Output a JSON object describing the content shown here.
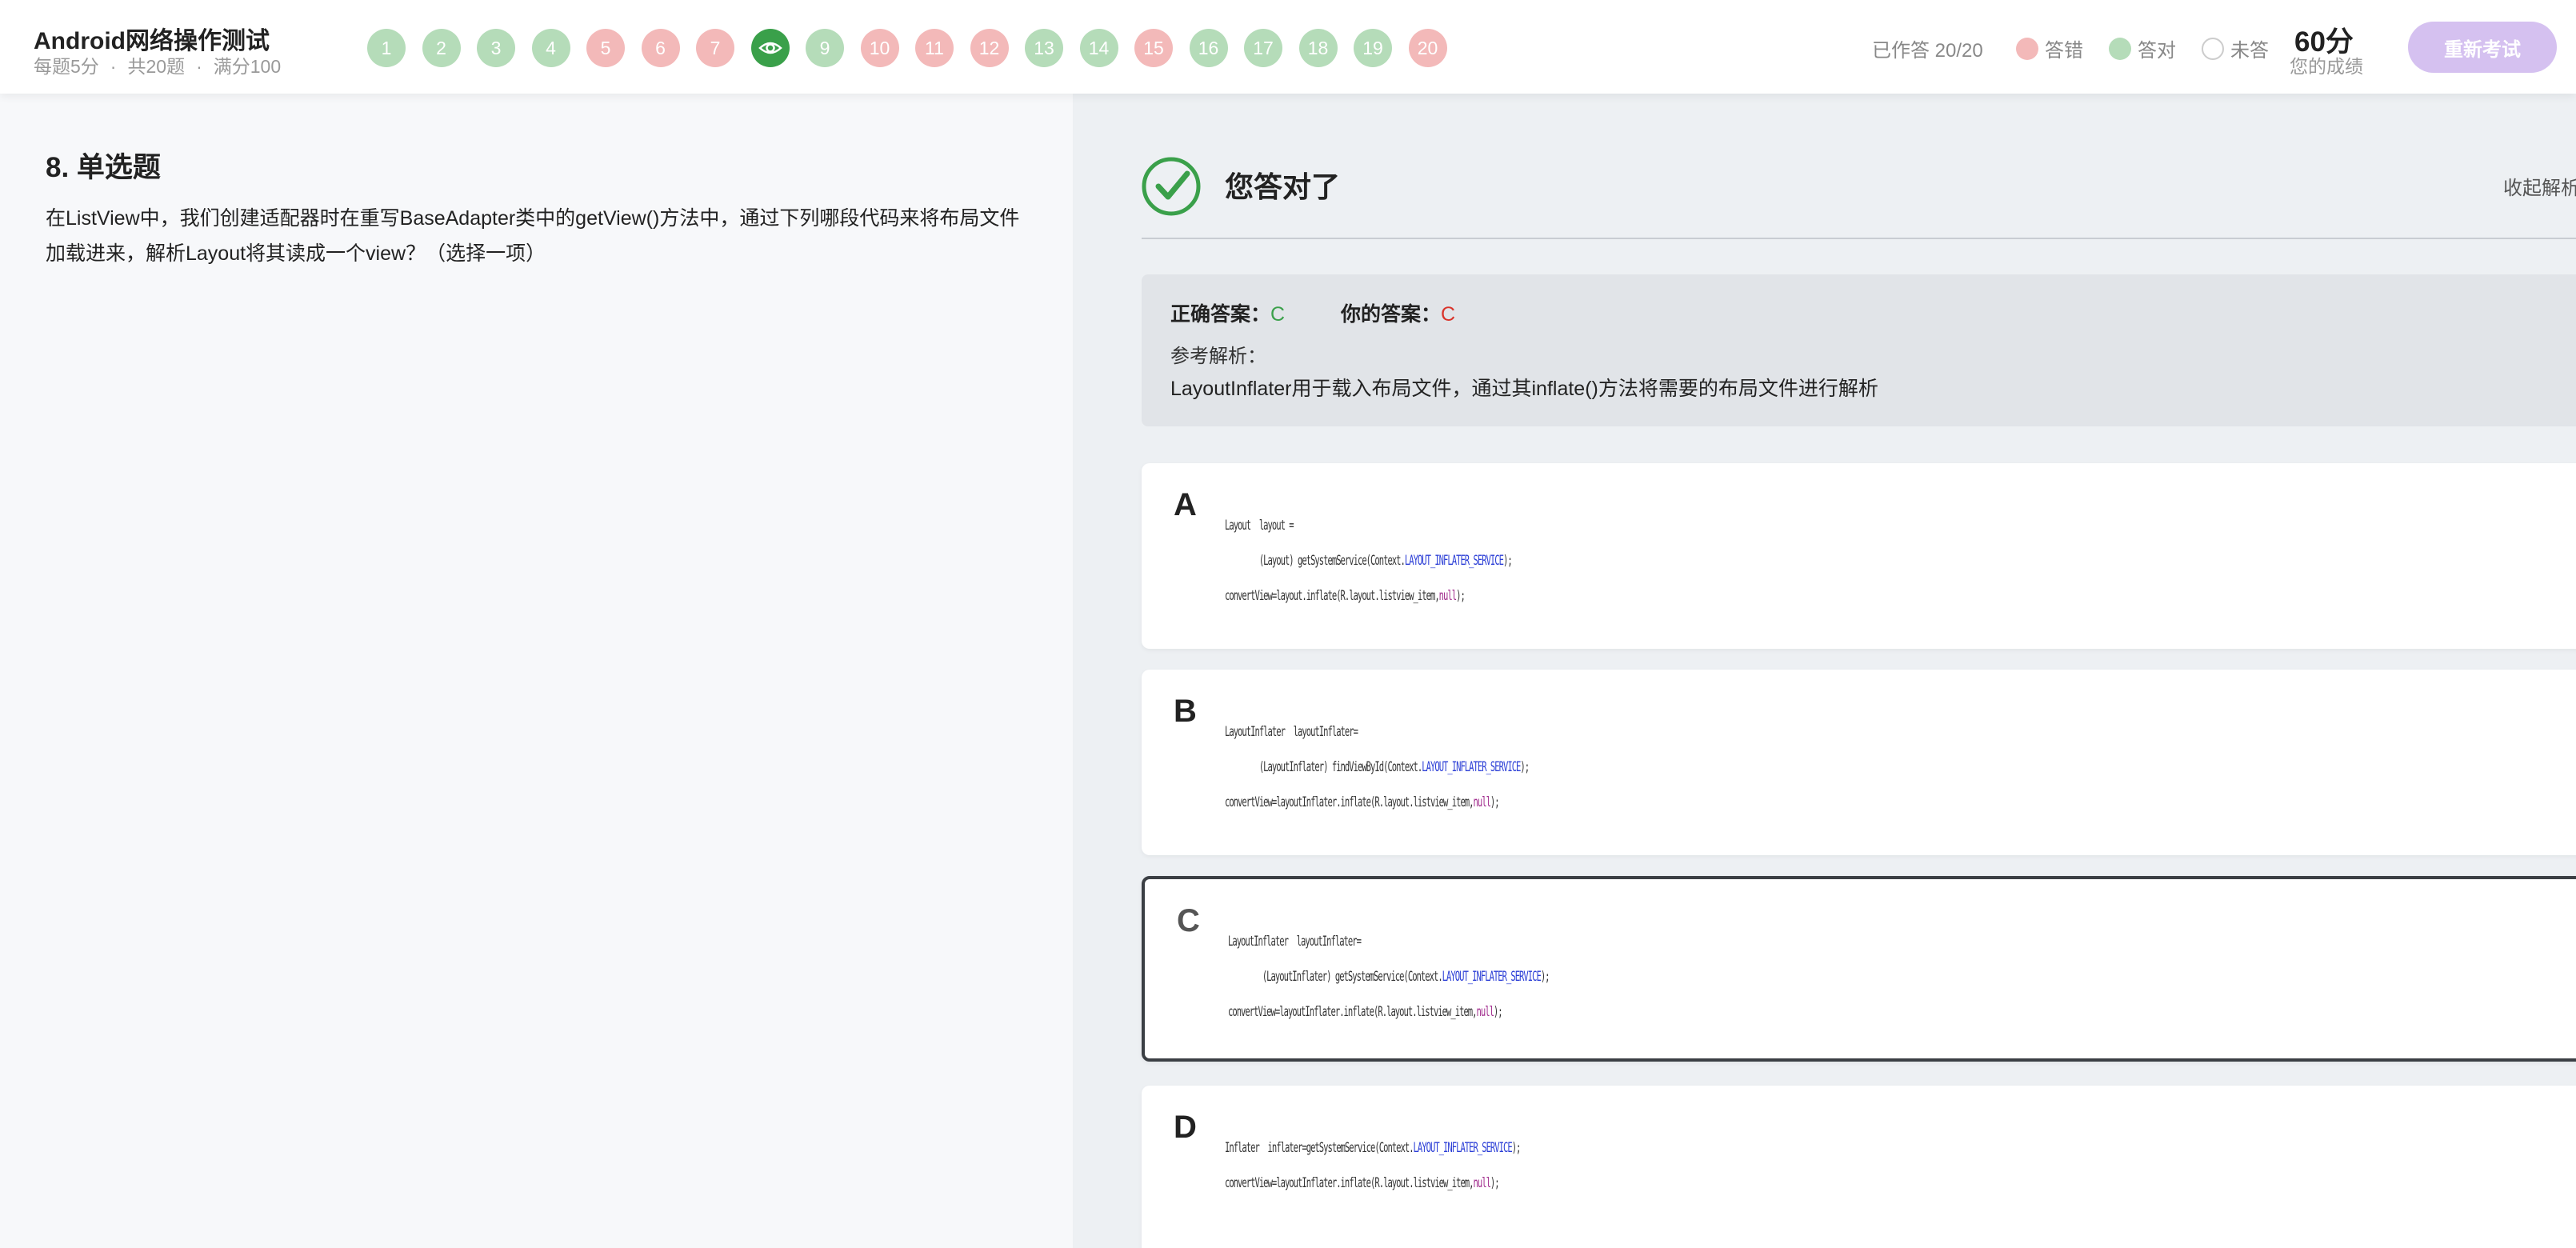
{
  "header": {
    "title": "Android网络操作测试",
    "subtitle_per_question": "每题5分",
    "subtitle_total": "共20题",
    "subtitle_full": "满分100",
    "subtitle_sep": "·",
    "questions": [
      {
        "label": "1",
        "status": "correct"
      },
      {
        "label": "2",
        "status": "correct"
      },
      {
        "label": "3",
        "status": "correct"
      },
      {
        "label": "4",
        "status": "correct"
      },
      {
        "label": "5",
        "status": "wrong"
      },
      {
        "label": "6",
        "status": "wrong"
      },
      {
        "label": "7",
        "status": "wrong"
      },
      {
        "label": "eye-icon",
        "status": "current"
      },
      {
        "label": "9",
        "status": "correct"
      },
      {
        "label": "10",
        "status": "wrong"
      },
      {
        "label": "11",
        "status": "wrong"
      },
      {
        "label": "12",
        "status": "wrong"
      },
      {
        "label": "13",
        "status": "correct"
      },
      {
        "label": "14",
        "status": "correct"
      },
      {
        "label": "15",
        "status": "wrong"
      },
      {
        "label": "16",
        "status": "correct"
      },
      {
        "label": "17",
        "status": "correct"
      },
      {
        "label": "18",
        "status": "correct"
      },
      {
        "label": "19",
        "status": "correct"
      },
      {
        "label": "20",
        "status": "wrong"
      }
    ],
    "done_text": "已作答 20/20",
    "legend_wrong": "答错",
    "legend_correct": "答对",
    "legend_unanswered": "未答",
    "score": "60分",
    "score_label": "您的成绩",
    "retake_label": "重新考试"
  },
  "colors": {
    "correct": "#b5dcb9",
    "wrong": "#f3b9b9",
    "current": "#3aa04a",
    "accent_green": "#3aa04a",
    "accent_red": "#d9342b",
    "retake_bg": "#d5c1f0"
  },
  "question": {
    "title": "8. 单选题",
    "text": "在ListView中，我们创建适配器时在重写BaseAdapter类中的getView()方法中，通过下列哪段代码来将布局文件加载进来，解析Layout将其读成一个view？（选择一项）"
  },
  "result": {
    "status_text": "您答对了",
    "collapse_label": "收起解析",
    "correct_answer_label": "正确答案：",
    "correct_answer": "C",
    "your_answer_label": "你的答案：",
    "your_answer": "C",
    "analysis_label": "参考解析：",
    "analysis_text": "LayoutInflater用于载入布局文件，通过其inflate()方法将需要的布局文件进行解析"
  },
  "options": [
    {
      "letter": "A",
      "lines": [
        [
          {
            "t": "Layout  layout ="
          }
        ],
        [
          {
            "t": "        (Layout) getSystemService(Context."
          },
          {
            "t": "LAYOUT_INFLATER_SERVICE",
            "c": "k"
          },
          {
            "t": ");"
          }
        ],
        [
          {
            "t": "convertView=layout.inflate(R.layout.listview_item,"
          },
          {
            "t": "null",
            "c": "n"
          },
          {
            "t": ");"
          }
        ]
      ]
    },
    {
      "letter": "B",
      "lines": [
        [
          {
            "t": "LayoutInflater  layoutInflater="
          }
        ],
        [
          {
            "t": "        (LayoutInflater) findViewById(Context."
          },
          {
            "t": "LAYOUT_INFLATER_SERVICE",
            "c": "k"
          },
          {
            "t": ");"
          }
        ],
        [
          {
            "t": "convertView=layoutInflater.inflate(R.layout.listview_item,"
          },
          {
            "t": "null",
            "c": "n"
          },
          {
            "t": ");"
          }
        ]
      ]
    },
    {
      "letter": "C",
      "lines": [
        [
          {
            "t": "LayoutInflater  layoutInflater="
          }
        ],
        [
          {
            "t": "        (LayoutInflater) getSystemService(Context."
          },
          {
            "t": "LAYOUT_INFLATER_SERVICE",
            "c": "k"
          },
          {
            "t": ");"
          }
        ],
        [
          {
            "t": "convertView=layoutInflater.inflate(R.layout.listview_item,"
          },
          {
            "t": "null",
            "c": "n"
          },
          {
            "t": ");"
          }
        ]
      ]
    },
    {
      "letter": "D",
      "lines": [
        [
          {
            "t": "Inflater  inflater=getSystemService(Context."
          },
          {
            "t": "LAYOUT_INFLATER_SERVICE",
            "c": "k"
          },
          {
            "t": ");"
          }
        ],
        [
          {
            "t": "convertView=layoutInflater.inflate(R.layout.listview_item,"
          },
          {
            "t": "null",
            "c": "n"
          },
          {
            "t": ");"
          }
        ]
      ]
    }
  ],
  "selected_option": "C"
}
